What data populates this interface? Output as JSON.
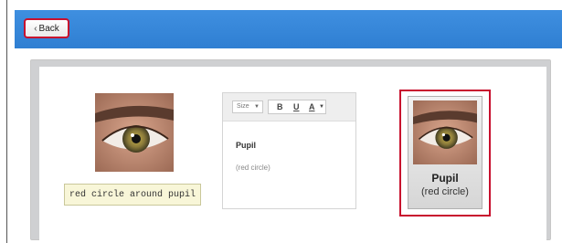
{
  "header": {
    "back_label": "Back"
  },
  "editor": {
    "size_label": "Size",
    "bold_label": "B",
    "underline_label": "U",
    "color_label": "A",
    "title": "Pupil",
    "subtitle": "(red circle)"
  },
  "caption": "red circle around pupil",
  "card": {
    "title": "Pupil",
    "subtitle": "(red circle)"
  },
  "colors": {
    "header_blue": "#3688dc",
    "highlight_red": "#c8102e",
    "caption_bg": "#f8f6d8"
  },
  "icons": {
    "back": "chevron-left-icon",
    "dropdown": "caret-down-icon"
  }
}
